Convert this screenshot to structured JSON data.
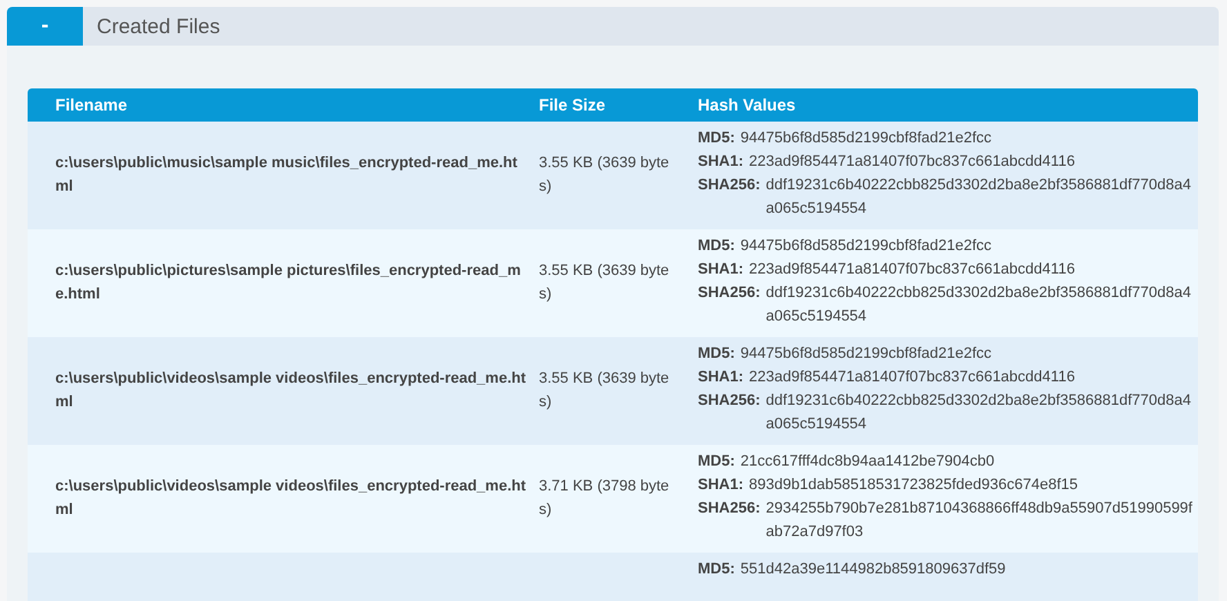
{
  "panel": {
    "toggle": "-",
    "title": "Created Files"
  },
  "table": {
    "columns": [
      "Filename",
      "File Size",
      "Hash Values"
    ],
    "rows": [
      {
        "filename": "c:\\users\\public\\music\\sample music\\files_encrypted-read_me.html",
        "size": "3.55 KB (3639 bytes)",
        "hashes": [
          {
            "label": "MD5:",
            "value": "94475b6f8d585d2199cbf8fad21e2fcc"
          },
          {
            "label": "SHA1:",
            "value": "223ad9f854471a81407f07bc837c661abcdd4116"
          },
          {
            "label": "SHA256:",
            "value": "ddf19231c6b40222cbb825d3302d2ba8e2bf3586881df770d8a4a065c5194554"
          }
        ]
      },
      {
        "filename": "c:\\users\\public\\pictures\\sample pictures\\files_encrypted-read_me.html",
        "size": "3.55 KB (3639 bytes)",
        "hashes": [
          {
            "label": "MD5:",
            "value": "94475b6f8d585d2199cbf8fad21e2fcc"
          },
          {
            "label": "SHA1:",
            "value": "223ad9f854471a81407f07bc837c661abcdd4116"
          },
          {
            "label": "SHA256:",
            "value": "ddf19231c6b40222cbb825d3302d2ba8e2bf3586881df770d8a4a065c5194554"
          }
        ]
      },
      {
        "filename": "c:\\users\\public\\videos\\sample videos\\files_encrypted-read_me.html",
        "size": "3.55 KB (3639 bytes)",
        "hashes": [
          {
            "label": "MD5:",
            "value": "94475b6f8d585d2199cbf8fad21e2fcc"
          },
          {
            "label": "SHA1:",
            "value": "223ad9f854471a81407f07bc837c661abcdd4116"
          },
          {
            "label": "SHA256:",
            "value": "ddf19231c6b40222cbb825d3302d2ba8e2bf3586881df770d8a4a065c5194554"
          }
        ]
      },
      {
        "filename": "c:\\users\\public\\videos\\sample videos\\files_encrypted-read_me.html",
        "size": "3.71 KB (3798 bytes)",
        "hashes": [
          {
            "label": "MD5:",
            "value": "21cc617fff4dc8b94aa1412be7904cb0"
          },
          {
            "label": "SHA1:",
            "value": "893d9b1dab58518531723825fded936c674e8f15"
          },
          {
            "label": "SHA256:",
            "value": "2934255b790b7e281b87104368866ff48db9a55907d51990599fab72a7d97f03"
          }
        ]
      },
      {
        "hashes": [
          {
            "label": "MD5:",
            "value": "551d42a39e1144982b8591809637df59"
          }
        ]
      }
    ]
  }
}
